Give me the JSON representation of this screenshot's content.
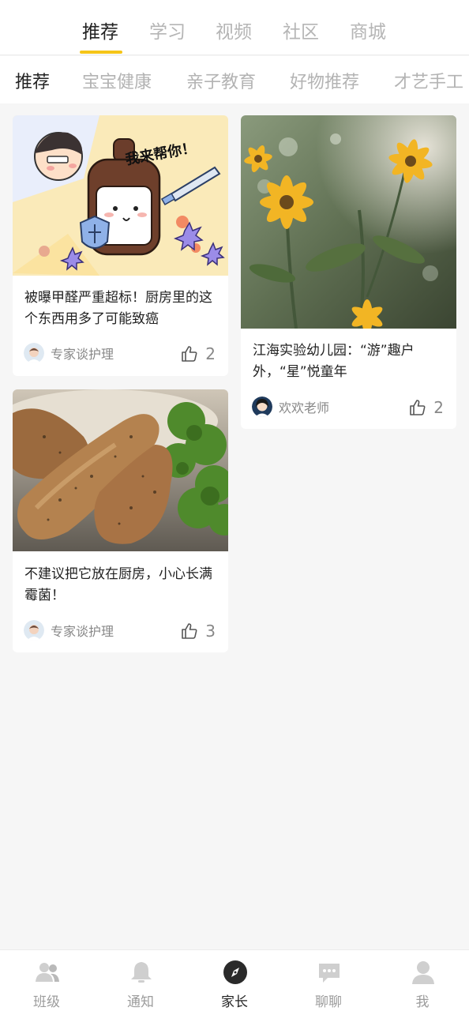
{
  "top_tabs": [
    {
      "label": "推荐",
      "active": true
    },
    {
      "label": "学习"
    },
    {
      "label": "视频"
    },
    {
      "label": "社区"
    },
    {
      "label": "商城"
    }
  ],
  "sub_categories": [
    {
      "label": "推荐",
      "active": true
    },
    {
      "label": "宝宝健康"
    },
    {
      "label": "亲子教育"
    },
    {
      "label": "好物推荐"
    },
    {
      "label": "才艺手工"
    }
  ],
  "cards": [
    {
      "image": "cartoon-bottle-illustration",
      "image_text": "我来帮你！",
      "title": "被曝甲醛严重超标！厨房里的这个东西用多了可能致癌",
      "author": "专家谈护理",
      "likes": "2"
    },
    {
      "image": "yellow-flowers-photo",
      "title": "江海实验幼儿园：“游”趣户外，“星”悦童年",
      "author": "欢欢老师",
      "likes": "2"
    },
    {
      "image": "chicken-broccoli-photo",
      "title": "不建议把它放在厨房，小心长满霉菌！",
      "author": "专家谈护理",
      "likes": "3"
    }
  ],
  "bottom_nav": [
    {
      "label": "班级",
      "icon": "class-people-icon"
    },
    {
      "label": "通知",
      "icon": "bell-icon"
    },
    {
      "label": "家长",
      "icon": "compass-icon",
      "active": true
    },
    {
      "label": "聊聊",
      "icon": "chat-bubble-icon"
    },
    {
      "label": "我",
      "icon": "person-icon"
    }
  ],
  "colors": {
    "accent": "#f5c518",
    "background": "#f6f6f6",
    "inactive_text": "#b5b5b5"
  }
}
